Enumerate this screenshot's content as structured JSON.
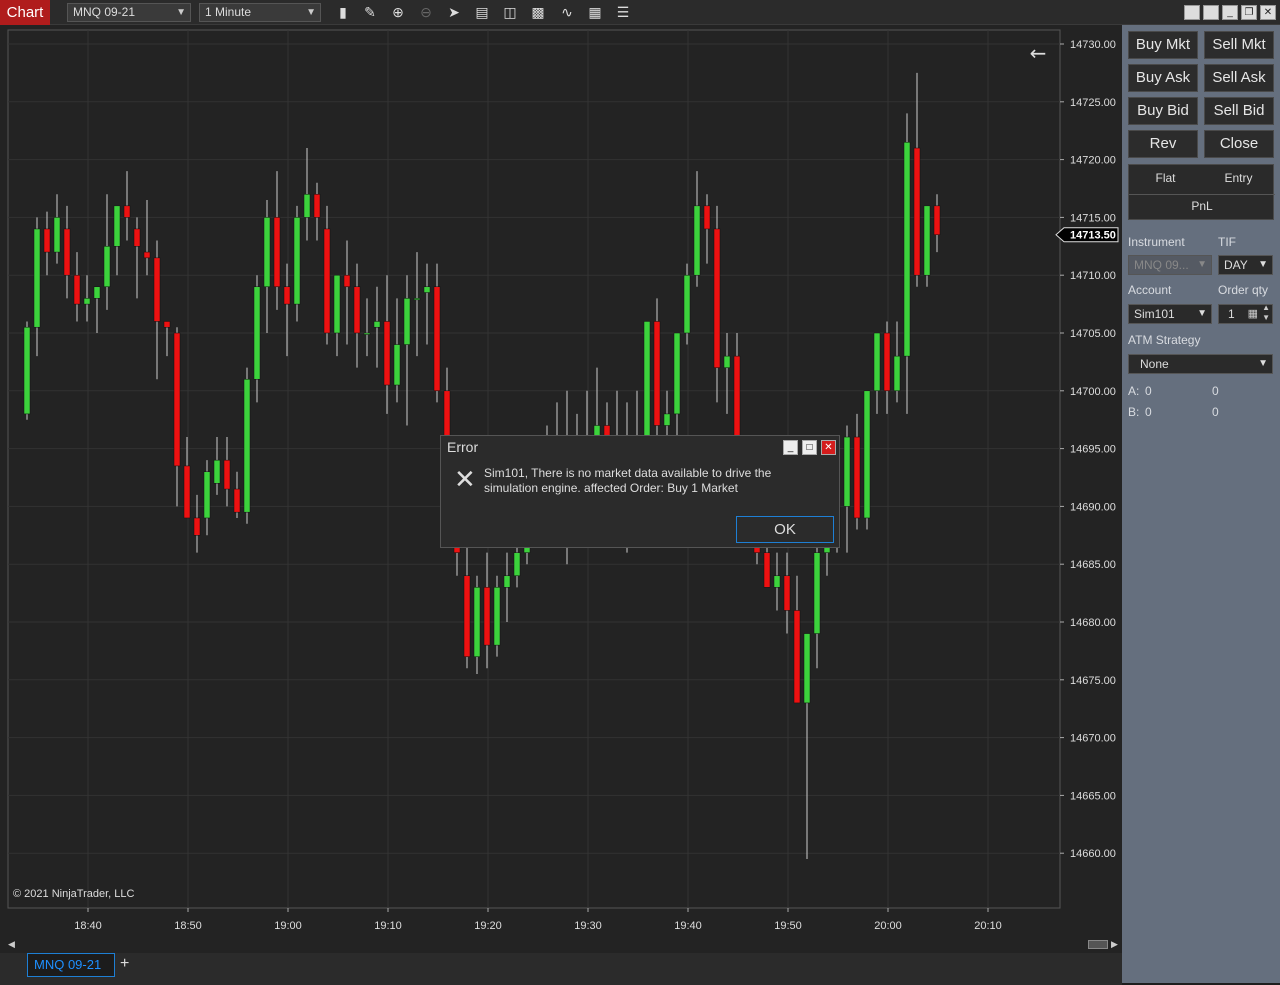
{
  "toolbar": {
    "chart_label": "Chart",
    "instrument": "MNQ 09-21",
    "interval": "1 Minute"
  },
  "chart": {
    "copyright": "© 2021 NinjaTrader, LLC",
    "current_price": "14713.50",
    "price_ticks": [
      "14730.00",
      "14725.00",
      "14720.00",
      "14715.00",
      "14710.00",
      "14705.00",
      "14700.00",
      "14695.00",
      "14690.00",
      "14685.00",
      "14680.00",
      "14675.00",
      "14670.00",
      "14665.00",
      "14660.00"
    ],
    "time_ticks": [
      "18:40",
      "18:50",
      "19:00",
      "19:10",
      "19:20",
      "19:30",
      "19:40",
      "19:50",
      "20:00",
      "20:10"
    ]
  },
  "chart_data": {
    "type": "candlestick",
    "ylim": [
      14658,
      14731
    ],
    "up_color": "#3cd33c",
    "down_color": "#ee1111",
    "candles": [
      {
        "o": 14698,
        "h": 14706,
        "l": 14697.5,
        "c": 14705.5
      },
      {
        "o": 14705.5,
        "h": 14715,
        "l": 14703,
        "c": 14714
      },
      {
        "o": 14714,
        "h": 14715.5,
        "l": 14710,
        "c": 14712
      },
      {
        "o": 14712,
        "h": 14717,
        "l": 14711,
        "c": 14715
      },
      {
        "o": 14714,
        "h": 14716,
        "l": 14708,
        "c": 14710
      },
      {
        "o": 14710,
        "h": 14712,
        "l": 14706,
        "c": 14707.5
      },
      {
        "o": 14707.5,
        "h": 14710,
        "l": 14706,
        "c": 14708
      },
      {
        "o": 14708,
        "h": 14709,
        "l": 14705,
        "c": 14709
      },
      {
        "o": 14709,
        "h": 14717,
        "l": 14707,
        "c": 14712.5
      },
      {
        "o": 14712.5,
        "h": 14716,
        "l": 14710,
        "c": 14716
      },
      {
        "o": 14716,
        "h": 14719,
        "l": 14713,
        "c": 14715
      },
      {
        "o": 14714,
        "h": 14715,
        "l": 14708,
        "c": 14712.5
      },
      {
        "o": 14712,
        "h": 14716.5,
        "l": 14710,
        "c": 14711.5
      },
      {
        "o": 14711.5,
        "h": 14713,
        "l": 14701,
        "c": 14706
      },
      {
        "o": 14706,
        "h": 14706,
        "l": 14703,
        "c": 14705.5
      },
      {
        "o": 14705,
        "h": 14705.5,
        "l": 14690,
        "c": 14693.5
      },
      {
        "o": 14693.5,
        "h": 14696,
        "l": 14689,
        "c": 14689
      },
      {
        "o": 14689,
        "h": 14691,
        "l": 14686,
        "c": 14687.5
      },
      {
        "o": 14689,
        "h": 14694,
        "l": 14687.5,
        "c": 14693
      },
      {
        "o": 14692,
        "h": 14696,
        "l": 14691,
        "c": 14694
      },
      {
        "o": 14694,
        "h": 14696,
        "l": 14690,
        "c": 14691.5
      },
      {
        "o": 14691.5,
        "h": 14693,
        "l": 14689,
        "c": 14689.5
      },
      {
        "o": 14689.5,
        "h": 14702,
        "l": 14688.5,
        "c": 14701
      },
      {
        "o": 14701,
        "h": 14710,
        "l": 14699,
        "c": 14709
      },
      {
        "o": 14709,
        "h": 14716.5,
        "l": 14705,
        "c": 14715
      },
      {
        "o": 14715,
        "h": 14719,
        "l": 14707,
        "c": 14709
      },
      {
        "o": 14709,
        "h": 14711,
        "l": 14703,
        "c": 14707.5
      },
      {
        "o": 14707.5,
        "h": 14716,
        "l": 14706,
        "c": 14715
      },
      {
        "o": 14715,
        "h": 14721,
        "l": 14713,
        "c": 14717
      },
      {
        "o": 14717,
        "h": 14718,
        "l": 14713,
        "c": 14715
      },
      {
        "o": 14714,
        "h": 14716,
        "l": 14704,
        "c": 14705
      },
      {
        "o": 14705,
        "h": 14709,
        "l": 14703,
        "c": 14710
      },
      {
        "o": 14710,
        "h": 14713,
        "l": 14704,
        "c": 14709
      },
      {
        "o": 14709,
        "h": 14711,
        "l": 14702,
        "c": 14705
      },
      {
        "o": 14705,
        "h": 14708,
        "l": 14703,
        "c": 14705
      },
      {
        "o": 14705.5,
        "h": 14709,
        "l": 14702,
        "c": 14706
      },
      {
        "o": 14706,
        "h": 14710,
        "l": 14698,
        "c": 14700.5
      },
      {
        "o": 14700.5,
        "h": 14708,
        "l": 14699,
        "c": 14704
      },
      {
        "o": 14704,
        "h": 14710,
        "l": 14697,
        "c": 14708
      },
      {
        "o": 14708,
        "h": 14712,
        "l": 14703,
        "c": 14708
      },
      {
        "o": 14708.5,
        "h": 14711,
        "l": 14704,
        "c": 14709
      },
      {
        "o": 14709,
        "h": 14711,
        "l": 14699,
        "c": 14700
      },
      {
        "o": 14700,
        "h": 14702,
        "l": 14688,
        "c": 14692
      },
      {
        "o": 14688,
        "h": 14690,
        "l": 14684,
        "c": 14686
      },
      {
        "o": 14684,
        "h": 14688,
        "l": 14676,
        "c": 14677
      },
      {
        "o": 14677,
        "h": 14684,
        "l": 14675.5,
        "c": 14683
      },
      {
        "o": 14683,
        "h": 14686,
        "l": 14676,
        "c": 14678
      },
      {
        "o": 14678,
        "h": 14684,
        "l": 14677,
        "c": 14683
      },
      {
        "o": 14683,
        "h": 14686,
        "l": 14680,
        "c": 14684
      },
      {
        "o": 14684,
        "h": 14688,
        "l": 14683,
        "c": 14686
      },
      {
        "o": 14686,
        "h": 14694,
        "l": 14685,
        "c": 14693
      },
      {
        "o": 14693,
        "h": 14696,
        "l": 14690,
        "c": 14694
      },
      {
        "o": 14694,
        "h": 14697,
        "l": 14690,
        "c": 14695
      },
      {
        "o": 14695,
        "h": 14699,
        "l": 14693,
        "c": 14695.5
      },
      {
        "o": 14694,
        "h": 14700,
        "l": 14685,
        "c": 14694
      },
      {
        "o": 14694,
        "h": 14698,
        "l": 14687,
        "c": 14694.5
      },
      {
        "o": 14694,
        "h": 14700,
        "l": 14690,
        "c": 14696
      },
      {
        "o": 14696,
        "h": 14702,
        "l": 14692,
        "c": 14697
      },
      {
        "o": 14697,
        "h": 14699,
        "l": 14693,
        "c": 14696
      },
      {
        "o": 14696,
        "h": 14700,
        "l": 14689,
        "c": 14695
      },
      {
        "o": 14695,
        "h": 14699,
        "l": 14686,
        "c": 14694
      },
      {
        "o": 14694,
        "h": 14700,
        "l": 14690,
        "c": 14696
      },
      {
        "o": 14696,
        "h": 14706,
        "l": 14692,
        "c": 14706
      },
      {
        "o": 14706,
        "h": 14708,
        "l": 14695,
        "c": 14697
      },
      {
        "o": 14697,
        "h": 14700,
        "l": 14694,
        "c": 14698
      },
      {
        "o": 14698,
        "h": 14705,
        "l": 14695,
        "c": 14705
      },
      {
        "o": 14705,
        "h": 14711,
        "l": 14704,
        "c": 14710
      },
      {
        "o": 14710,
        "h": 14719,
        "l": 14709,
        "c": 14716
      },
      {
        "o": 14716,
        "h": 14717,
        "l": 14711,
        "c": 14714
      },
      {
        "o": 14714,
        "h": 14716,
        "l": 14699,
        "c": 14702
      },
      {
        "o": 14702,
        "h": 14705,
        "l": 14698,
        "c": 14703
      },
      {
        "o": 14703,
        "h": 14705,
        "l": 14690,
        "c": 14693
      },
      {
        "o": 14693,
        "h": 14695,
        "l": 14688,
        "c": 14689
      },
      {
        "o": 14690,
        "h": 14692,
        "l": 14685,
        "c": 14686
      },
      {
        "o": 14686,
        "h": 14689,
        "l": 14683,
        "c": 14683
      },
      {
        "o": 14683,
        "h": 14686,
        "l": 14681,
        "c": 14684
      },
      {
        "o": 14684,
        "h": 14686,
        "l": 14679,
        "c": 14681
      },
      {
        "o": 14681,
        "h": 14684,
        "l": 14675,
        "c": 14673
      },
      {
        "o": 14673,
        "h": 14676,
        "l": 14659.5,
        "c": 14679
      },
      {
        "o": 14679,
        "h": 14688,
        "l": 14676,
        "c": 14686
      },
      {
        "o": 14686,
        "h": 14689,
        "l": 14684,
        "c": 14686.5
      },
      {
        "o": 14686.5,
        "h": 14690,
        "l": 14686,
        "c": 14690
      },
      {
        "o": 14690,
        "h": 14697,
        "l": 14686,
        "c": 14696
      },
      {
        "o": 14696,
        "h": 14698,
        "l": 14688,
        "c": 14689
      },
      {
        "o": 14689,
        "h": 14700,
        "l": 14688,
        "c": 14700
      },
      {
        "o": 14700,
        "h": 14704,
        "l": 14698,
        "c": 14705
      },
      {
        "o": 14705,
        "h": 14706,
        "l": 14698,
        "c": 14700
      },
      {
        "o": 14700,
        "h": 14706,
        "l": 14699,
        "c": 14703
      },
      {
        "o": 14703,
        "h": 14724,
        "l": 14698,
        "c": 14721.5
      },
      {
        "o": 14721,
        "h": 14727.5,
        "l": 14709,
        "c": 14710
      },
      {
        "o": 14710,
        "h": 14716,
        "l": 14709,
        "c": 14716
      },
      {
        "o": 14716,
        "h": 14717,
        "l": 14712,
        "c": 14713.5
      }
    ]
  },
  "panel": {
    "buy_mkt": "Buy Mkt",
    "sell_mkt": "Sell Mkt",
    "buy_ask": "Buy Ask",
    "sell_ask": "Sell Ask",
    "buy_bid": "Buy Bid",
    "sell_bid": "Sell Bid",
    "rev": "Rev",
    "close": "Close",
    "flat": "Flat",
    "entry": "Entry",
    "pnl": "PnL",
    "instrument_label": "Instrument",
    "tif_label": "TIF",
    "instrument_value": "MNQ 09...",
    "tif_value": "DAY",
    "account_label": "Account",
    "order_qty_label": "Order qty",
    "account_value": "Sim101",
    "order_qty_value": "1",
    "atm_label": "ATM Strategy",
    "atm_value": "None",
    "a_label": "A:",
    "a_val1": "0",
    "a_val2": "0",
    "b_label": "B:",
    "b_val1": "0",
    "b_val2": "0"
  },
  "dialog": {
    "title": "Error",
    "message_line1": "Sim101, There is no market data available to drive the",
    "message_line2": "simulation engine. affected Order: Buy 1 Market",
    "ok_label": "OK"
  },
  "tabs": {
    "active_tab": "MNQ 09-21",
    "add_tab": "+"
  }
}
